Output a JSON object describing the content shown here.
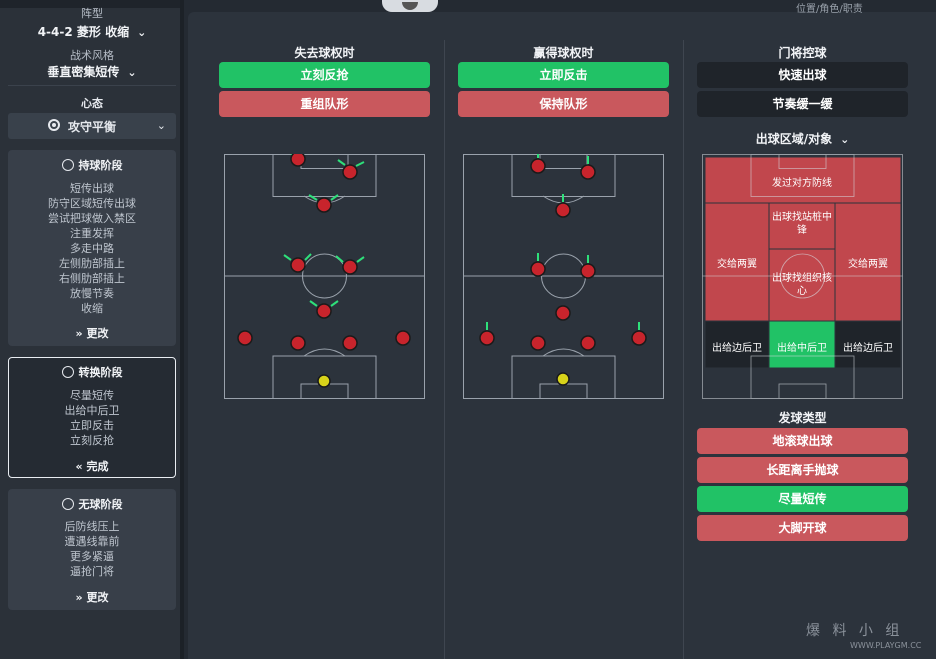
{
  "left_panel": {
    "formation_label": "阵型",
    "formation_value": "4-4-2 菱形 收缩",
    "style_label": "战术风格",
    "style_value": "垂直密集短传",
    "mentality_label": "心态",
    "mentality_value": "攻守平衡",
    "in_possession": {
      "title": "持球阶段",
      "items": [
        "短传出球",
        "防守区域短传出球",
        "尝试把球做入禁区",
        "注重发挥",
        "多走中路",
        "左侧肋部插上",
        "右侧肋部插上",
        "放慢节奏",
        "收缩"
      ],
      "action": "更改"
    },
    "transition": {
      "title": "转换阶段",
      "items": [
        "尽量短传",
        "出给中后卫",
        "立即反击",
        "立刻反抢"
      ],
      "action": "完成"
    },
    "out_of_possession": {
      "title": "无球阶段",
      "items": [
        "后防线压上",
        "遭遇线靠前",
        "更多紧逼",
        "逼抢门将"
      ],
      "action": "更改"
    }
  },
  "top_right_label": "位置/角色/职责",
  "columns": {
    "lose": {
      "title": "失去球权时",
      "buttons": [
        {
          "label": "立刻反抢",
          "state": "selected"
        },
        {
          "label": "重组队形",
          "state": "unselected"
        }
      ]
    },
    "win": {
      "title": "赢得球权时",
      "buttons": [
        {
          "label": "立即反击",
          "state": "selected"
        },
        {
          "label": "保持队形",
          "state": "unselected"
        }
      ]
    },
    "gk": {
      "title": "门将控球",
      "buttons": [
        {
          "label": "快速出球",
          "state": "neutral"
        },
        {
          "label": "节奏缓一缓",
          "state": "neutral"
        }
      ],
      "distribution_title": "出球区域/对象",
      "zones": {
        "over_defence": "发过对方防线",
        "target_forward": "出球找站桩中锋",
        "left_wing": "交给两翼",
        "right_wing": "交给两翼",
        "playmaker": "出球找组织核心",
        "left_fullback": "出给边后卫",
        "center_backs": "出给中后卫",
        "right_fullback": "出给边后卫"
      },
      "kick_type_title": "发球类型",
      "kick_buttons": [
        {
          "label": "地滚球出球",
          "state": "unselected"
        },
        {
          "label": "长距离手抛球",
          "state": "unselected"
        },
        {
          "label": "尽量短传",
          "state": "selected"
        },
        {
          "label": "大脚开球",
          "state": "unselected"
        }
      ]
    }
  },
  "colors": {
    "green": "#21c266",
    "red": "#c9585d",
    "dark": "#1f242a",
    "zone_red": "#c1474d",
    "player_red": "#c8242c",
    "gk_yellow": "#d8d31a",
    "arrow_green": "#2ee07a"
  },
  "watermark": {
    "text": "爆 料 小 组",
    "url": "WWW.PLAYGM.CC"
  }
}
